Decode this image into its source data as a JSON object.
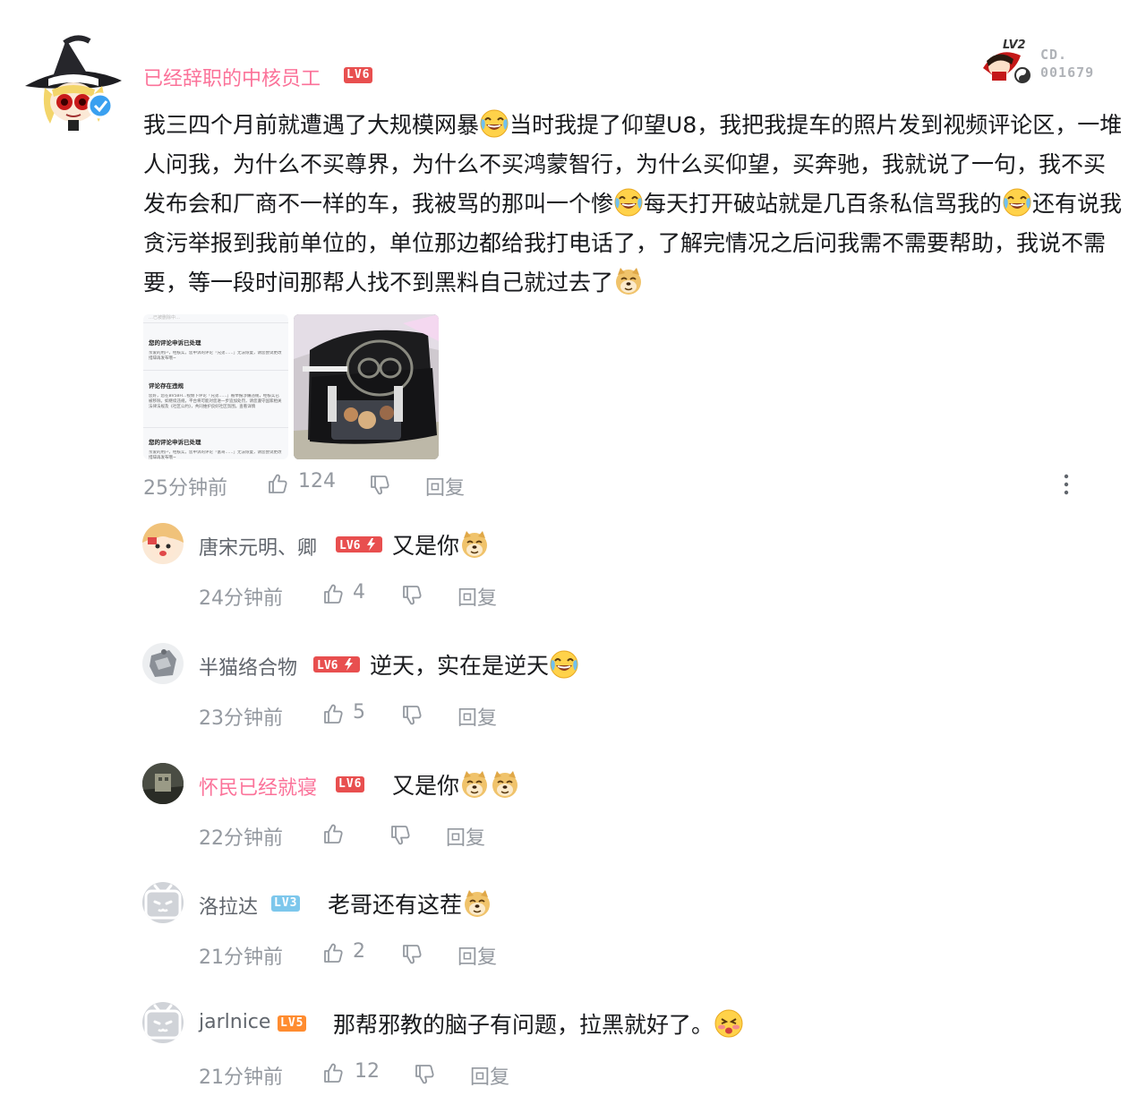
{
  "main_comment": {
    "username": "已经辞职的中核员工",
    "level": "LV6",
    "fan_medal": {
      "medal_level": "LV2",
      "label": "CD.",
      "number": "001679"
    },
    "text_segments": [
      "我三四个月前就遭遇了大规模网暴",
      "当时我提了仰望U8，我把我提车的照片发到视频评论区，一堆人问我，为什么不买尊界，为什么不买鸿蒙智行，为什么买仰望，买奔驰，我就说了一句，我不买发布会和厂商不一样的车，我被骂的那叫一个惨",
      "每天打开破站就是几百条私信骂我的",
      "还有说我贪污举报到我前单位的，单位那边都给我打电话了，了解完情况之后问我需不需要帮助，我说不需要，等一段时间那帮人找不到黑料自己就过去了"
    ],
    "emotes": [
      "laughing-crying-emote",
      "laughing-crying-emote",
      "laughing-crying-emote",
      "doge-emote"
    ],
    "images": [
      {
        "type": "screenshot",
        "top_line": "…已被删除中…",
        "notices": [
          {
            "title": "您的评论申诉已处理",
            "body": "亲爱的用户，经核实，您申诉的评论「兄弟……」无法恢复，请您尝试更改措辞再发布哦~"
          },
          {
            "title": "评论存在违规",
            "body": "您好，您在BV5BH…视频下评论「兄弟……」被举报涉嫌违规，经核实已被移除。如继续违规，平台将可能对您进一步追加处罚，请您遵守国家相关法律法规及《社区公约》，共同维护良好社区氛围。查看详情"
          },
          {
            "title": "您的评论申诉已处理",
            "body": "亲爱的用户，经核实，您申诉的评论「富哥……」无法恢复，请您尝试更改措辞再发布哦~"
          }
        ]
      },
      {
        "type": "photo",
        "label": "bag-photo"
      }
    ],
    "time": "25分钟前",
    "likes": "124",
    "reply_label": "回复"
  },
  "replies": [
    {
      "username": "唐宋元明、卿",
      "level": "LV6",
      "vip": true,
      "name_color": "gray",
      "text": "又是你",
      "emotes": [
        "doge-emote"
      ],
      "time": "24分钟前",
      "likes": "4",
      "reply_label": "回复"
    },
    {
      "username": "半猫络合物",
      "level": "LV6",
      "vip": true,
      "name_color": "gray",
      "text": "逆天，实在是逆天",
      "emotes": [
        "laughing-crying-emote"
      ],
      "time": "23分钟前",
      "likes": "5",
      "reply_label": "回复"
    },
    {
      "username": "怀民已经就寝",
      "level": "LV6",
      "vip": false,
      "name_color": "pink",
      "text": "又是你",
      "emotes": [
        "doge-emote",
        "doge-emote"
      ],
      "time": "22分钟前",
      "likes": "",
      "reply_label": "回复"
    },
    {
      "username": "洛拉达",
      "level": "LV3",
      "vip": false,
      "name_color": "gray",
      "text": "老哥还有这茬",
      "emotes": [
        "doge-emote"
      ],
      "time": "21分钟前",
      "likes": "2",
      "reply_label": "回复"
    },
    {
      "username": "jarlnice",
      "level": "LV5",
      "vip": false,
      "name_color": "gray",
      "text": "那帮邪教的脑子有问题，拉黑就好了。",
      "emotes": [
        "cheeky-emote"
      ],
      "time": "21分钟前",
      "likes": "12",
      "reply_label": "回复"
    }
  ],
  "colors": {
    "username_vip": "#fb7299",
    "meta_gray": "#9499a0",
    "lv6": "#e84f4f",
    "lv5": "#ff8c30",
    "lv3": "#7dc7ec"
  }
}
